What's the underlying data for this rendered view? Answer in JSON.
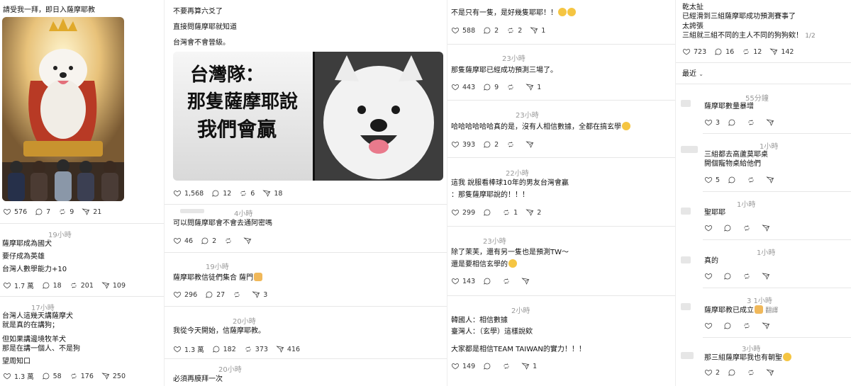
{
  "col1": {
    "p1": {
      "text": "請受我一拜，即日入薩摩耶教",
      "likes": "576",
      "replies": "7",
      "reposts": "9",
      "shares": "21"
    },
    "p2": {
      "time": "19小時",
      "lines": [
        "薩摩耶成為國犬",
        "要仔成為英雄",
        "台灣人數學能力+10"
      ],
      "likes": "1.7 萬",
      "replies": "18",
      "reposts": "201",
      "shares": "109"
    },
    "p3": {
      "time": "17小時",
      "lines": [
        "台灣人這幾天講薩摩犬",
        "就是真的在講狗；",
        "但如果講邊境牧羊犬",
        "那是在講一個人、不是狗",
        "望周知口"
      ],
      "likes": "1.3 萬",
      "replies": "58",
      "reposts": "176",
      "shares": "250"
    }
  },
  "col2": {
    "p1": {
      "lines": [
        "不要再算六爻了",
        "直接問薩摩耶就知道",
        "台灣會不會晉級。"
      ],
      "banner_lines": [
        "台灣隊：",
        "那隻薩摩耶說",
        "我們會贏"
      ],
      "likes": "1,568",
      "replies": "12",
      "reposts": "6",
      "shares": "18"
    },
    "p2": {
      "time": "4小時",
      "text": "可以問薩摩耶會不會去通阿密嗎",
      "likes": "46",
      "replies": "2"
    },
    "p3": {
      "time": "19小時",
      "text": "薩摩耶教信徒們集合 薩門",
      "likes": "296",
      "replies": "27",
      "shares": "3"
    },
    "p4": {
      "time": "20小時",
      "text": "我從今天開始，信薩摩耶教。",
      "likes": "1.3 萬",
      "replies": "182",
      "reposts": "373",
      "shares": "416"
    },
    "p5": {
      "time": "20小時",
      "text": "必須再膜拜一次"
    }
  },
  "col3": {
    "p1": {
      "text": "不是只有一隻，是好幾隻耶耶！！",
      "likes": "588",
      "replies": "2",
      "reposts": "2",
      "shares": "1"
    },
    "p2": {
      "time": "23小時",
      "text": "那隻薩摩耶已經成功預測三場了。",
      "likes": "443",
      "replies": "9",
      "shares": "1"
    },
    "p3": {
      "time": "23小時",
      "text": "哈哈哈哈哈哈真的是，沒有人相信數據，全都在搞玄學",
      "likes": "393",
      "replies": "2"
    },
    "p4": {
      "time": "22小時",
      "lines": [
        "這我 說服看棒球10年的男友台灣會贏",
        "：那隻薩摩耶說的！！！"
      ],
      "likes": "299",
      "reposts": "1",
      "shares": "2"
    },
    "p5": {
      "time": "23小時",
      "lines": [
        "除了茉芙，還有另一隻也是預測TW～",
        "還是要相信玄學的"
      ],
      "likes": "143"
    },
    "p6": {
      "time": "2小時",
      "lines": [
        "韓國人：相信數據",
        "臺灣人：（玄學）這樣說欸",
        "",
        "大家都是相信TEAM TAIWAN的實力！！！"
      ],
      "likes": "149",
      "shares": "1"
    }
  },
  "col4": {
    "top": {
      "lines": [
        "乾太扯",
        "已經滑到三組薩摩耶成功預測賽事了",
        "太誇張",
        "三組就三組不同的主人不同的狗狗欸！"
      ],
      "pager": "1/2",
      "likes": "723",
      "replies": "16",
      "reposts": "12",
      "shares": "142"
    },
    "sort": "最近",
    "c1": {
      "time": "55分鐘",
      "text": "薩摩耶數量暴增",
      "likes": "3"
    },
    "c2": {
      "time": "1小時",
      "lines": [
        "三組都去高蘆莫耶桌",
        "開個寵物桌給他們"
      ],
      "likes": "5"
    },
    "c3": {
      "time": "1小時",
      "text": "聖耶耶"
    },
    "c4": {
      "time": "1小時",
      "text": "真的"
    },
    "c5": {
      "time": "3 1小時",
      "text": "薩摩耶教已成立",
      "translate": "翻譯"
    },
    "c6": {
      "time": "3小時",
      "text": "那三組薩摩耶我也有朝聖",
      "likes": "2"
    }
  },
  "colors": {
    "muted": "#999999",
    "divider": "#e7e7e7",
    "banner_bg": "#f2f2f2"
  }
}
